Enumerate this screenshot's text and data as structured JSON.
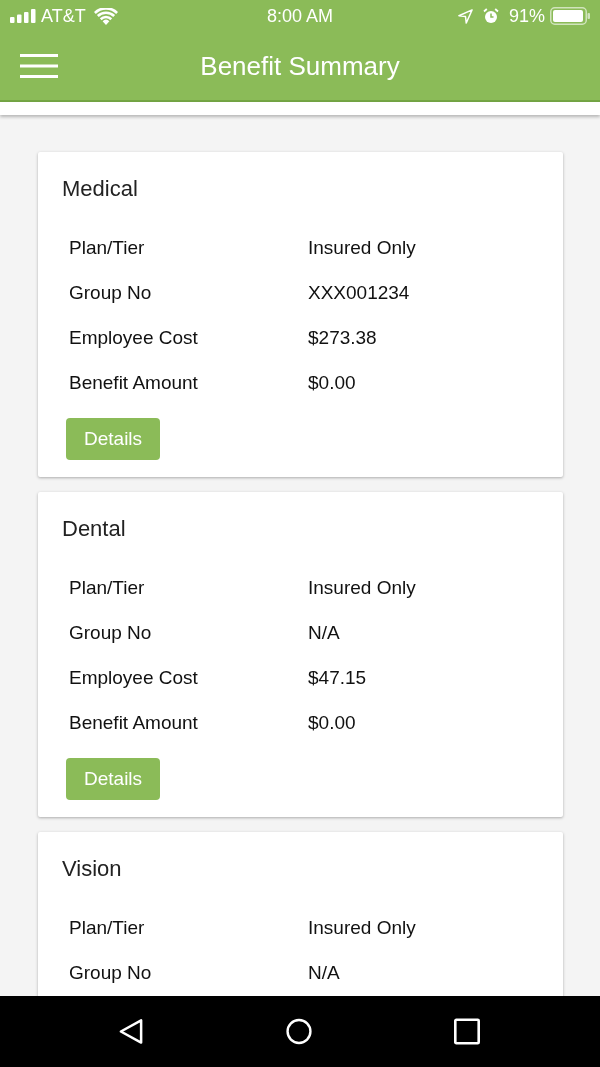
{
  "status_bar": {
    "carrier": "AT&T",
    "time": "8:00 AM",
    "battery": "91%"
  },
  "app_bar": {
    "title": "Benefit Summary"
  },
  "cards": [
    {
      "title": "Medical",
      "rows": [
        {
          "label": "Plan/Tier",
          "value": "Insured Only"
        },
        {
          "label": "Group No",
          "value": "XXX001234"
        },
        {
          "label": "Employee Cost",
          "value": "$273.38"
        },
        {
          "label": "Benefit Amount",
          "value": "$0.00"
        }
      ],
      "button": "Details"
    },
    {
      "title": "Dental",
      "rows": [
        {
          "label": "Plan/Tier",
          "value": "Insured Only"
        },
        {
          "label": "Group No",
          "value": "N/A"
        },
        {
          "label": "Employee Cost",
          "value": "$47.15"
        },
        {
          "label": "Benefit Amount",
          "value": "$0.00"
        }
      ],
      "button": "Details"
    },
    {
      "title": "Vision",
      "rows": [
        {
          "label": "Plan/Tier",
          "value": "Insured Only"
        },
        {
          "label": "Group No",
          "value": "N/A"
        }
      ]
    }
  ]
}
